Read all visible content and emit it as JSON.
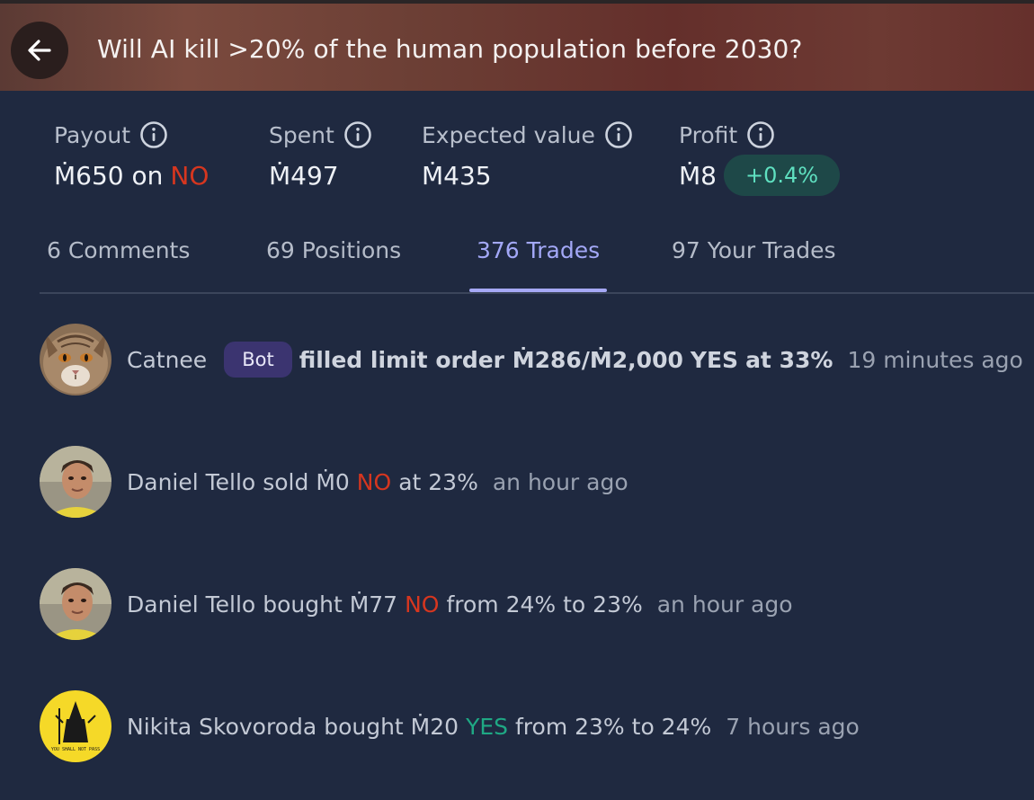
{
  "header": {
    "title": "Will AI kill >20% of the human population before 2030?"
  },
  "stats": {
    "payout": {
      "label": "Payout",
      "value": "Ṁ650 on",
      "outcome": "NO"
    },
    "spent": {
      "label": "Spent",
      "value": "Ṁ497"
    },
    "expected_value": {
      "label": "Expected value",
      "value": "Ṁ435"
    },
    "profit": {
      "label": "Profit",
      "value": "Ṁ8",
      "change": "+0.4%"
    }
  },
  "tabs": [
    {
      "label": "6 Comments"
    },
    {
      "label": "69 Positions"
    },
    {
      "label": "376 Trades",
      "active": true
    },
    {
      "label": "97 Your Trades"
    }
  ],
  "trades": [
    {
      "user": "Catnee",
      "badge": "Bot",
      "action": "filled limit order Ṁ286/Ṁ2,000",
      "outcome": "YES",
      "detail": "at 33%",
      "time": "19 minutes ago"
    },
    {
      "user": "Daniel Tello",
      "action": "sold Ṁ0",
      "outcome": "NO",
      "detail": "at 23%",
      "time": "an hour ago"
    },
    {
      "user": "Daniel Tello",
      "action": "bought Ṁ77",
      "outcome": "NO",
      "detail": "from 24% to 23%",
      "time": "an hour ago"
    },
    {
      "user": "Nikita Skovoroda",
      "action": "bought Ṁ20",
      "outcome": "YES",
      "detail": "from 23% to 24%",
      "time": "7 hours ago",
      "avatar_text": "YOU SHALL NOT PASS"
    }
  ],
  "colors": {
    "no": "#d6361f",
    "yes": "#1fa884",
    "accent": "#a3a8f7",
    "background": "#1f2940"
  }
}
